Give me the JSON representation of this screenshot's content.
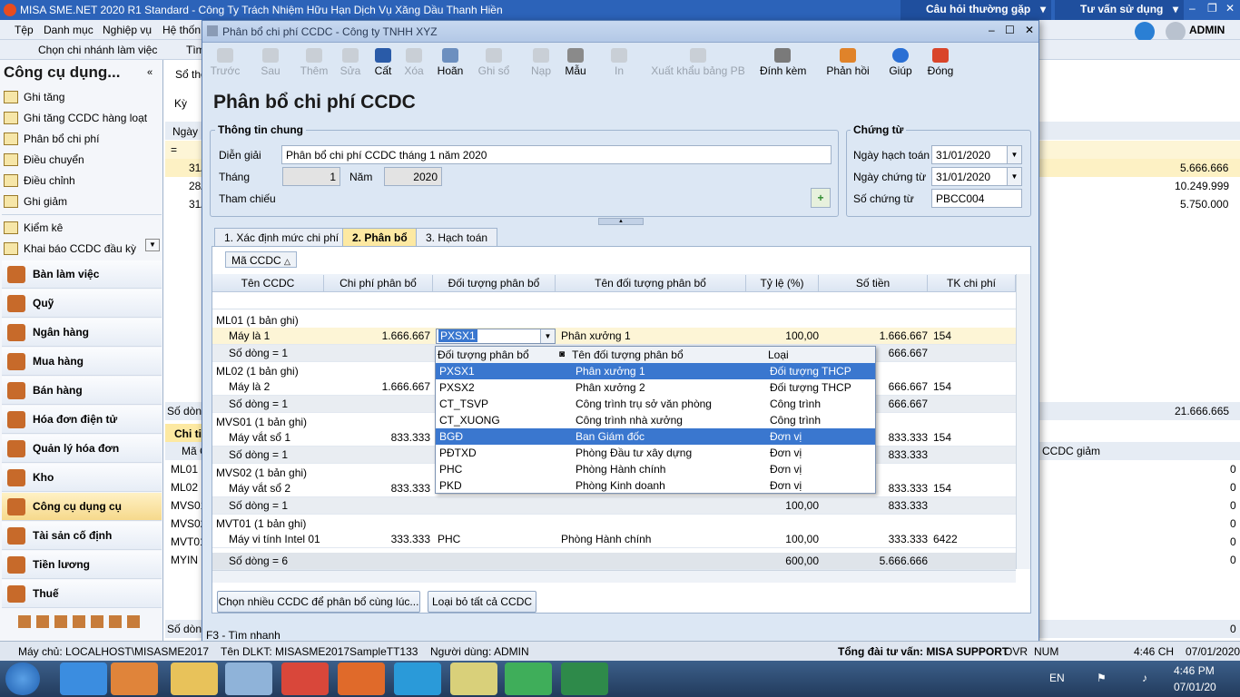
{
  "app": {
    "title": "MISA SME.NET 2020 R1 Standard - Công Ty Trách Nhiệm Hữu Hạn Dịch Vụ Xăng Dầu Thanh Hiền",
    "help1": "Câu hỏi thường gặp",
    "help2": "Tư vấn sử dụng",
    "user": "ADMIN"
  },
  "menu": {
    "items": [
      "Tệp",
      "Danh mục",
      "Nghiệp vụ",
      "Hệ thốn"
    ],
    "branch": "Chọn chi nhánh làm việc",
    "find": "Tìm"
  },
  "sidebar": {
    "title": "Công cụ dụng...",
    "items": [
      "Ghi tăng",
      "Ghi tăng CCDC hàng loạt",
      "Phân bổ chi phí",
      "Điều chuyển",
      "Điều chỉnh",
      "Ghi giảm",
      "Kiểm kê",
      "Khai báo CCDC đầu kỳ"
    ],
    "modules": [
      "Bàn làm việc",
      "Quỹ",
      "Ngân hàng",
      "Mua hàng",
      "Bán hàng",
      "Hóa đơn điện tử",
      "Quản lý hóa đơn",
      "Kho",
      "Công cụ dụng cụ",
      "Tài sản cố định",
      "Tiền lương",
      "Thuế"
    ]
  },
  "background": {
    "tab": "Sổ the",
    "ky": "Kỳ",
    "col_ngay": "Ngày h",
    "rows": [
      "31/",
      "28/",
      "31/"
    ],
    "amounts": [
      "5.666.666",
      "10.249.999",
      "5.750.000"
    ],
    "so_dong": "Số dòng",
    "total": "21.666.665",
    "chi_tiet": "Chi ti",
    "ma": "Mã C",
    "codes": [
      "ML01",
      "ML02",
      "MVS01",
      "MVS02",
      "MVT01",
      "MYIN"
    ],
    "ccdc_giam": "CCDC giảm",
    "zeros": [
      "0",
      "0",
      "0",
      "0",
      "0",
      "0"
    ],
    "so_dong2": "Số dòn",
    "so_dong2_val": "0"
  },
  "dialog": {
    "title": "Phân bổ chi phí CCDC - Công ty TNHH XYZ",
    "heading": "Phân bổ chi phí CCDC",
    "toolbar": [
      "Trước",
      "Sau",
      "Thêm",
      "Sửa",
      "Cất",
      "Xóa",
      "Hoãn",
      "Ghi sổ",
      "Nạp",
      "Mẫu",
      "In",
      "Xuất khẩu bảng PB",
      "Đính kèm",
      "Phản hồi",
      "Giúp",
      "Đóng"
    ],
    "info_title": "Thông tin chung",
    "dien_giai_lbl": "Diễn giải",
    "dien_giai": "Phân bổ chi phí CCDC tháng 1 năm 2020",
    "thang_lbl": "Tháng",
    "thang": "1",
    "nam_lbl": "Năm",
    "nam": "2020",
    "tham_chieu": "Tham chiếu",
    "ct_title": "Chứng từ",
    "ngay_ht_lbl": "Ngày hạch toán",
    "ngay_ht": "31/01/2020",
    "ngay_ct_lbl": "Ngày chứng từ",
    "ngay_ct": "31/01/2020",
    "so_ct_lbl": "Số chứng từ",
    "so_ct": "PBCC004",
    "tabs": [
      "1. Xác định mức chi phí",
      "2. Phân bổ",
      "3. Hạch toán"
    ],
    "group_chip": "Mã CCDC",
    "columns": [
      "Tên CCDC",
      "Chi phí phân bổ",
      "Đối tượng phân bổ",
      "Tên đối tượng phân bổ",
      "Tỷ lệ (%)",
      "Số tiền",
      "TK chi phí"
    ],
    "groups": [
      {
        "label": "ML01 (1 bản ghi)",
        "name": "Máy là 1",
        "cost": "1.666.667",
        "obj": "PXSX1",
        "objname": "Phân xưởng 1",
        "pct": "100,00",
        "amt": "1.666.667",
        "tk": "154",
        "count": "Số dòng = 1",
        "camt": "666.667"
      },
      {
        "label": "ML02 (1 bản ghi)",
        "name": "Máy là 2",
        "cost": "1.666.667",
        "amt": "666.667",
        "tk": "154",
        "count": "Số dòng = 1",
        "camt": "666.667"
      },
      {
        "label": "MVS01 (1 bản ghi)",
        "name": "Máy vắt sổ 1",
        "cost": "833.333",
        "amt": "833.333",
        "tk": "154",
        "count": "Số dòng = 1",
        "camt": "833.333"
      },
      {
        "label": "MVS02 (1 bản ghi)",
        "name": "Máy vắt sổ 2",
        "cost": "833.333",
        "amt": "833.333",
        "tk": "154",
        "count": "Số dòng = 1",
        "cpct": "100,00",
        "camt": "833.333"
      },
      {
        "label": "MVT01 (1 bản ghi)",
        "name": "Máy  vi  tính Intel 01",
        "cost": "333.333",
        "obj": "PHC",
        "objname": "Phòng Hành chính",
        "pct": "100,00",
        "amt": "333.333",
        "tk": "6422"
      }
    ],
    "total_label": "Số dòng = 6",
    "total_pct": "600,00",
    "total_amt": "5.666.666",
    "dropdown": {
      "headers": [
        "Đối tượng phân bổ",
        "Tên đối tượng phân bổ",
        "Loại"
      ],
      "rows": [
        [
          "PXSX1",
          "Phân xưởng 1",
          "Đối tượng THCP"
        ],
        [
          "PXSX2",
          "Phân xưởng 2",
          "Đối tượng THCP"
        ],
        [
          "CT_TSVP",
          "Công trình trụ sở văn phòng",
          "Công trình"
        ],
        [
          "CT_XUONG",
          "Công trình nhà xưởng",
          "Công trình"
        ],
        [
          "BGĐ",
          "Ban Giám đốc",
          "Đơn vị"
        ],
        [
          "PĐTXD",
          "Phòng Đầu tư xây dựng",
          "Đơn vị"
        ],
        [
          "PHC",
          "Phòng Hành chính",
          "Đơn vị"
        ],
        [
          "PKD",
          "Phòng Kinh doanh",
          "Đơn vị"
        ]
      ]
    },
    "btn1": "Chọn nhiều CCDC để phân bổ cùng lúc...",
    "btn2": "Loại bỏ tất cả CCDC",
    "hint": "F3 - Tìm nhanh"
  },
  "status": {
    "server": "Máy chủ: LOCALHOST\\MISASME2017",
    "dlkt": "Tên DLKT: MISASME2017SampleTT133",
    "user": "Người dùng: ADMIN",
    "support": "Tổng đài tư vấn: MISA SUPPORT",
    "ovr": "OVR",
    "num": "NUM",
    "time": "4:46 CH",
    "date": "07/01/2020"
  },
  "taskbar": {
    "lang": "EN",
    "time": "4:46 PM",
    "date": "07/01/20"
  }
}
